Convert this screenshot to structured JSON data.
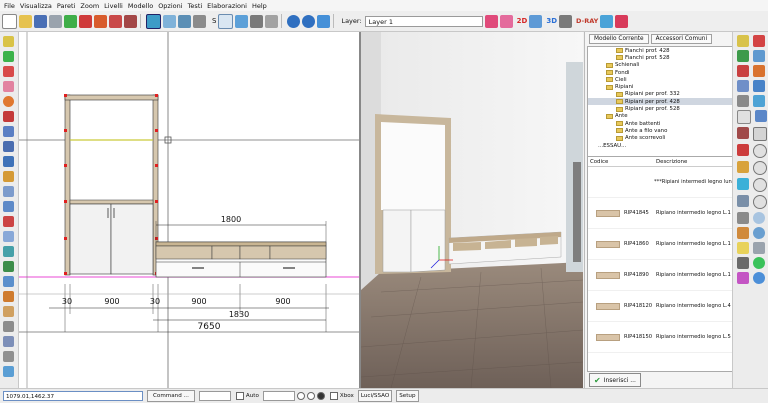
{
  "menu": {
    "items": [
      "File",
      "Visualizza",
      "Pareti",
      "Zoom",
      "Livelli",
      "Modello",
      "Opzioni",
      "Testi",
      "Elaborazioni",
      "Help"
    ]
  },
  "toolbar": {
    "layer_label": "Layer:",
    "layer_value": "Layer 1",
    "mode_2d": "2D",
    "mode_3d": "3D",
    "render": "D-RAY",
    "snap_value": "S",
    "colors": {
      "mode_2d": "#d62828",
      "mode_3d": "#2a6fd6",
      "render": "#c0392b"
    }
  },
  "drawing": {
    "dimensions": [
      "1800",
      "30",
      "900",
      "30",
      "900",
      "900",
      "1830",
      "7650"
    ]
  },
  "panel": {
    "tab_current": "Modello Corrente",
    "tab_common": "Accessori Comuni",
    "tree": [
      "Fianchi prof. 428",
      "Fianchi prof. 528",
      "Schienali",
      "Fondi",
      "Cieli",
      "Ripiani",
      "Ripiani per prof. 332",
      "Ripiani per prof. 428",
      "Ripiani per prof. 528",
      "Ante",
      "Ante battenti",
      "Ante a filo vano",
      "Ante scorrevoli",
      "...ESSAU..."
    ],
    "list_header": {
      "code": "Codice",
      "desc": "Descrizione"
    },
    "list_rows": [
      {
        "code": "",
        "desc": "***Ripiani intermedi legno lun"
      },
      {
        "code": "RIP41845",
        "desc": "Ripiano intermedio legno L.1"
      },
      {
        "code": "RIP41860",
        "desc": "Ripiano intermedio legno L.1"
      },
      {
        "code": "RIP41890",
        "desc": "Ripiano intermedio legno L.1"
      },
      {
        "code": "RIP418120",
        "desc": "Ripiano intermedio legno L.4"
      },
      {
        "code": "RIP418150",
        "desc": "Ripiano intermedio legno L.5"
      }
    ],
    "insert_label": "Inserisci ..."
  },
  "status": {
    "coords": "1079.01,1462.37",
    "command_label": "Command ...",
    "auto_label": "Auto",
    "xbox_label": "Xbox",
    "ssao_label": "Luci/SSAO",
    "setup_label": "Setup"
  }
}
